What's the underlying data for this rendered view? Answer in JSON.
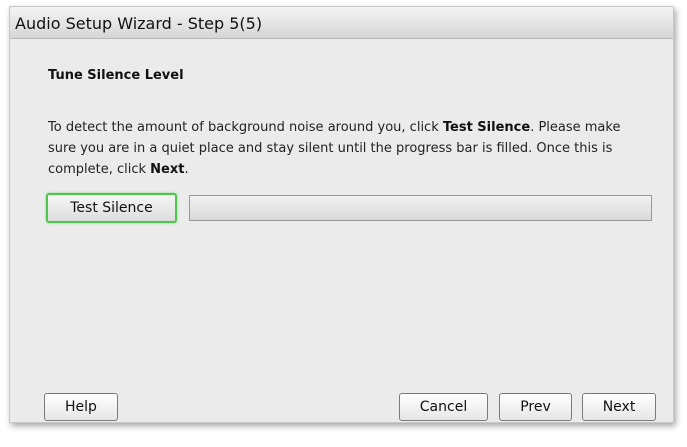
{
  "window": {
    "title": "Audio Setup Wizard - Step 5(5)"
  },
  "section": {
    "title": "Tune Silence Level"
  },
  "instructions": {
    "part1": "To detect the amount of background noise around you, click ",
    "bold1": "Test Silence",
    "part2": ". Please make sure you are in a quiet place and stay silent until the progress bar is filled. Once this is complete, click ",
    "bold2": "Next",
    "part3": "."
  },
  "test_button": {
    "label": "Test Silence"
  },
  "progress": {
    "value": 0
  },
  "footer": {
    "help_label": "Help",
    "cancel_label": "Cancel",
    "prev_label": "Prev",
    "next_label": "Next"
  },
  "colors": {
    "focus_ring": "#4dc64d",
    "dialog_bg": "#ebebeb"
  }
}
